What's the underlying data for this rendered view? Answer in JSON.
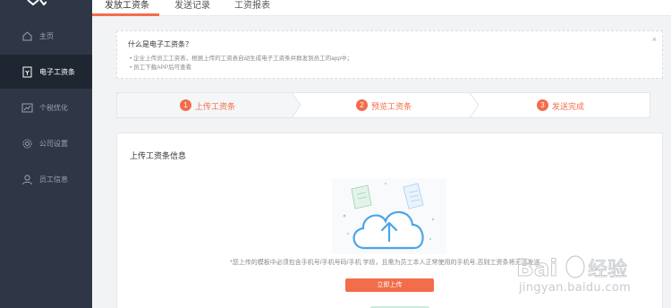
{
  "sidebar": {
    "items": [
      {
        "label": "主页",
        "icon": "home-icon"
      },
      {
        "label": "电子工资条",
        "icon": "payslip-icon"
      },
      {
        "label": "个税优化",
        "icon": "chart-icon"
      },
      {
        "label": "公司设置",
        "icon": "gear-icon"
      },
      {
        "label": "员工信息",
        "icon": "user-icon"
      }
    ]
  },
  "top_tabs": [
    {
      "label": "发放工资条"
    },
    {
      "label": "发送记录"
    },
    {
      "label": "工资报表"
    }
  ],
  "notice": {
    "title": "什么是电子工资条？",
    "lines": [
      "企业上传员工工资表，根据上传的工资表自动生成电子工资条并群发到员工的app中；",
      "员工下载APP后可查看"
    ],
    "close": "×"
  },
  "steps": [
    {
      "num": "1",
      "label": "上传工资条"
    },
    {
      "num": "2",
      "label": "预览工资条"
    },
    {
      "num": "3",
      "label": "发送完成"
    }
  ],
  "card": {
    "title": "上传工资条信息",
    "hint": "*您上传的模板中必须包含手机号/手机号码/手机 字段，且需为员工本人正常使用的手机号,否则工资条将无法发送",
    "upload_label": "立即上传"
  },
  "watermark": {
    "brand": "Bai",
    "brand2": "经验",
    "url": "jingyan.baidu.com"
  },
  "colors": {
    "accent": "#f26d4a",
    "sidebar_bg": "#2f3746",
    "sidebar_active": "#1f2632",
    "cloud": "#4aa5e8"
  }
}
